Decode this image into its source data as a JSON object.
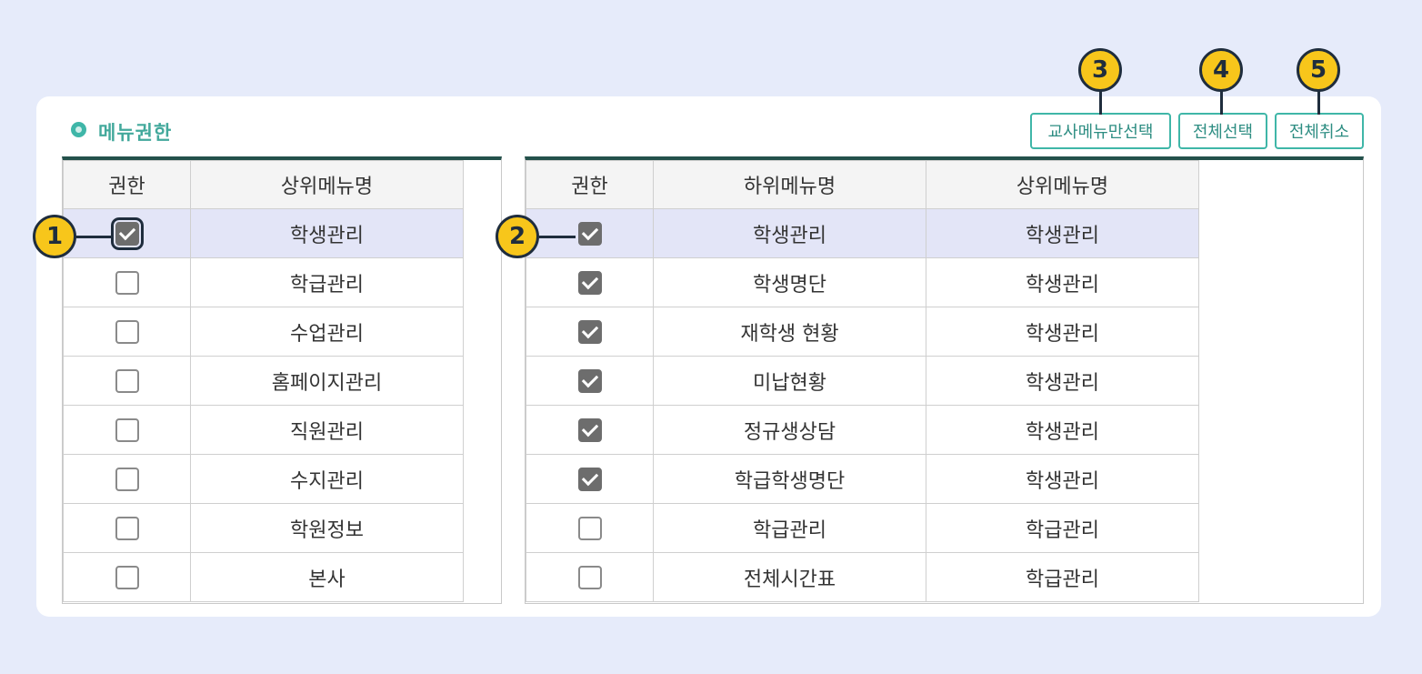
{
  "section": {
    "title": "메뉴권한"
  },
  "toolbar": {
    "teacher_only_label": "교사메뉴만선택",
    "select_all_label": "전체선택",
    "cancel_all_label": "전체취소"
  },
  "markers": [
    "1",
    "2",
    "3",
    "4",
    "5"
  ],
  "left_table": {
    "headers": [
      "권한",
      "상위메뉴명"
    ],
    "rows": [
      {
        "checked": true,
        "name": "학생관리"
      },
      {
        "checked": false,
        "name": "학급관리"
      },
      {
        "checked": false,
        "name": "수업관리"
      },
      {
        "checked": false,
        "name": "홈페이지관리"
      },
      {
        "checked": false,
        "name": "직원관리"
      },
      {
        "checked": false,
        "name": "수지관리"
      },
      {
        "checked": false,
        "name": "학원정보"
      },
      {
        "checked": false,
        "name": "본사"
      }
    ]
  },
  "right_table": {
    "headers": [
      "권한",
      "하위메뉴명",
      "상위메뉴명"
    ],
    "rows": [
      {
        "checked": true,
        "sub": "학생관리",
        "parent": "학생관리"
      },
      {
        "checked": true,
        "sub": "학생명단",
        "parent": "학생관리"
      },
      {
        "checked": true,
        "sub": "재학생 현황",
        "parent": "학생관리"
      },
      {
        "checked": true,
        "sub": "미납현황",
        "parent": "학생관리"
      },
      {
        "checked": true,
        "sub": "정규생상담",
        "parent": "학생관리"
      },
      {
        "checked": true,
        "sub": "학급학생명단",
        "parent": "학생관리"
      },
      {
        "checked": false,
        "sub": "학급관리",
        "parent": "학급관리"
      },
      {
        "checked": false,
        "sub": "전체시간표",
        "parent": "학급관리"
      }
    ]
  }
}
